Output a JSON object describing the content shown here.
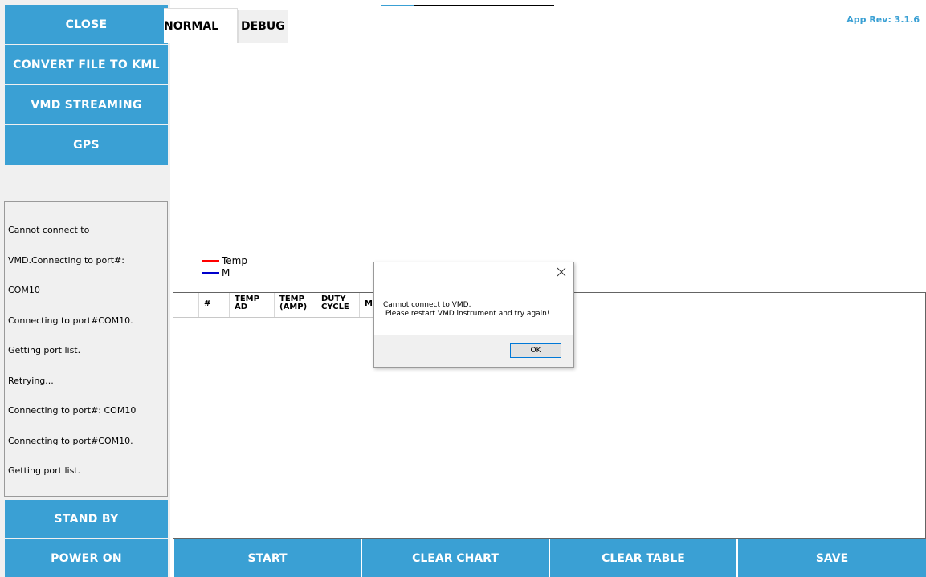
{
  "sidebar": {
    "close_label": "CLOSE",
    "convert_label": "CONVERT FILE TO KML",
    "vmd_streaming_label": "VMD STREAMING",
    "gps_label": "GPS",
    "standby_label": "STAND BY",
    "power_on_label": "POWER ON"
  },
  "log": {
    "lines": [
      "Cannot connect to",
      "VMD.Connecting to port#:",
      "COM10",
      "Connecting to port#COM10.",
      "Getting port list.",
      "Retrying...",
      "Connecting to port#: COM10",
      "Connecting to port#COM10.",
      "Getting port list."
    ]
  },
  "tabs": {
    "normal": "NORMAL",
    "debug": "DEBUG"
  },
  "app_rev": "App Rev: 3.1.6",
  "legend": {
    "temp": "Temp",
    "m": "M",
    "temp_color": "#ff0000",
    "m_color": "#0000cc"
  },
  "table": {
    "headers": [
      "",
      "#",
      "TEMP\nAD",
      "TEMP\n(AMP)",
      "DUTY\nCYCLE",
      "M"
    ]
  },
  "toolbar": {
    "start": "START",
    "clear_chart": "CLEAR CHART",
    "clear_table": "CLEAR TABLE",
    "save": "SAVE"
  },
  "dialog": {
    "message_line1": "Cannot connect to VMD.",
    "message_line2": " Please restart VMD instrument and try again!",
    "ok_label": "OK"
  },
  "colors": {
    "accent": "#3aa0d4",
    "panel_bg": "#f0f0f0"
  }
}
